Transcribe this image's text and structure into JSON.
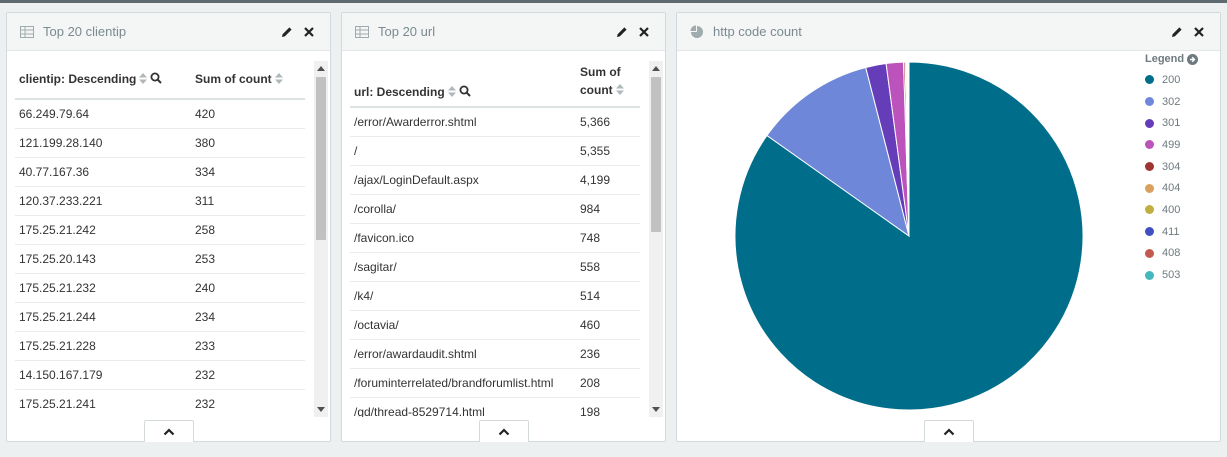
{
  "panels": {
    "clientip": {
      "title": "Top 20 clientip",
      "col1": "clientip: Descending",
      "col2": "Sum of count",
      "rows": [
        [
          "66.249.79.64",
          "420"
        ],
        [
          "121.199.28.140",
          "380"
        ],
        [
          "40.77.167.36",
          "334"
        ],
        [
          "120.37.233.221",
          "311"
        ],
        [
          "175.25.21.242",
          "258"
        ],
        [
          "175.25.20.143",
          "253"
        ],
        [
          "175.25.21.232",
          "240"
        ],
        [
          "175.25.21.244",
          "234"
        ],
        [
          "175.25.21.228",
          "233"
        ],
        [
          "14.150.167.179",
          "232"
        ],
        [
          "175.25.21.241",
          "232"
        ]
      ]
    },
    "url": {
      "title": "Top 20 url",
      "col1": "url: Descending",
      "col2_line1": "Sum of",
      "col2_line2": "count",
      "rows": [
        [
          "/error/Awarderror.shtml",
          "5,366"
        ],
        [
          "/",
          "5,355"
        ],
        [
          "/ajax/LoginDefault.aspx",
          "4,199"
        ],
        [
          "/corolla/",
          "984"
        ],
        [
          "/favicon.ico",
          "748"
        ],
        [
          "/sagitar/",
          "558"
        ],
        [
          "/k4/",
          "514"
        ],
        [
          "/octavia/",
          "460"
        ],
        [
          "/error/awardaudit.shtml",
          "236"
        ],
        [
          "/foruminterrelated/brandforumlist.html",
          "208"
        ],
        [
          "/gd/thread-8529714.html",
          "198"
        ]
      ]
    },
    "http": {
      "title": "http code count",
      "legend_title": "Legend"
    }
  },
  "chart_data": {
    "type": "pie",
    "categories": [
      "200",
      "302",
      "301",
      "499",
      "304",
      "404",
      "400",
      "411",
      "408",
      "503"
    ],
    "values": [
      84.8,
      11.2,
      1.9,
      1.6,
      0.15,
      0.12,
      0.08,
      0.06,
      0.05,
      0.04
    ],
    "colors": [
      "#006e8a",
      "#6f87d8",
      "#663db8",
      "#bc52bc",
      "#9e3533",
      "#daa05d",
      "#bfaf40",
      "#4050c0",
      "#c45a4f",
      "#44b7bf"
    ],
    "legend_position": "right"
  }
}
